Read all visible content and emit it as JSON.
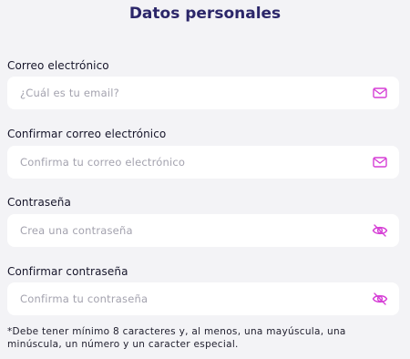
{
  "title": "Datos personales",
  "fields": [
    {
      "label": "Correo electrónico",
      "placeholder": "¿Cuál es tu email?",
      "icon": "mail-icon"
    },
    {
      "label": "Confirmar correo electrónico",
      "placeholder": "Confirma tu correo electrónico",
      "icon": "mail-icon"
    },
    {
      "label": "Contraseña",
      "placeholder": "Crea una contraseña",
      "icon": "eye-off-icon"
    },
    {
      "label": "Confirmar contraseña",
      "placeholder": "Confirma tu contraseña",
      "icon": "eye-off-icon"
    }
  ],
  "note": "*Debe tener mínimo 8 caracteres y, al menos, una mayúscula, una minúscula, un número y un caracter especial.",
  "colors": {
    "title": "#2b2669",
    "icon_accent": "#d63fd6",
    "background": "#f3f3f6",
    "input_background": "#ffffff",
    "placeholder": "#a3a2ae"
  }
}
